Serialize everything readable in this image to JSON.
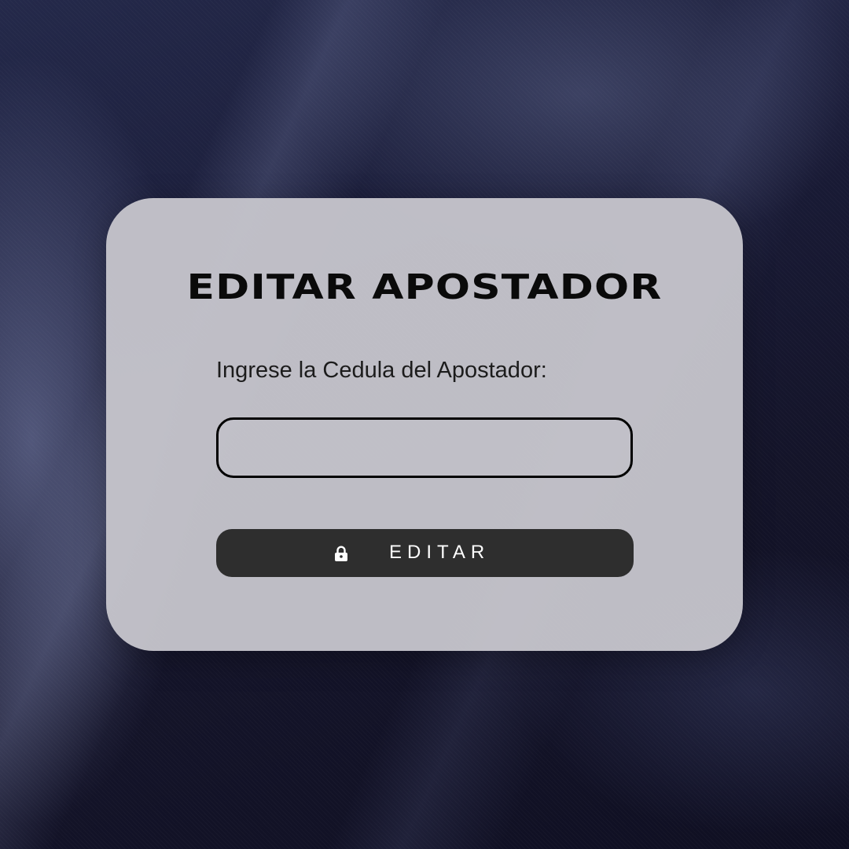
{
  "form": {
    "title": "EDITAR APOSTADOR",
    "field_label": "Ingrese la Cedula del Apostador:",
    "cedula_value": "",
    "button": {
      "label": "EDITAR",
      "icon": "lock-icon"
    }
  },
  "colors": {
    "card_background": "#c4c3ca",
    "button_background": "#2e2e2e",
    "page_background": "#14142a"
  }
}
